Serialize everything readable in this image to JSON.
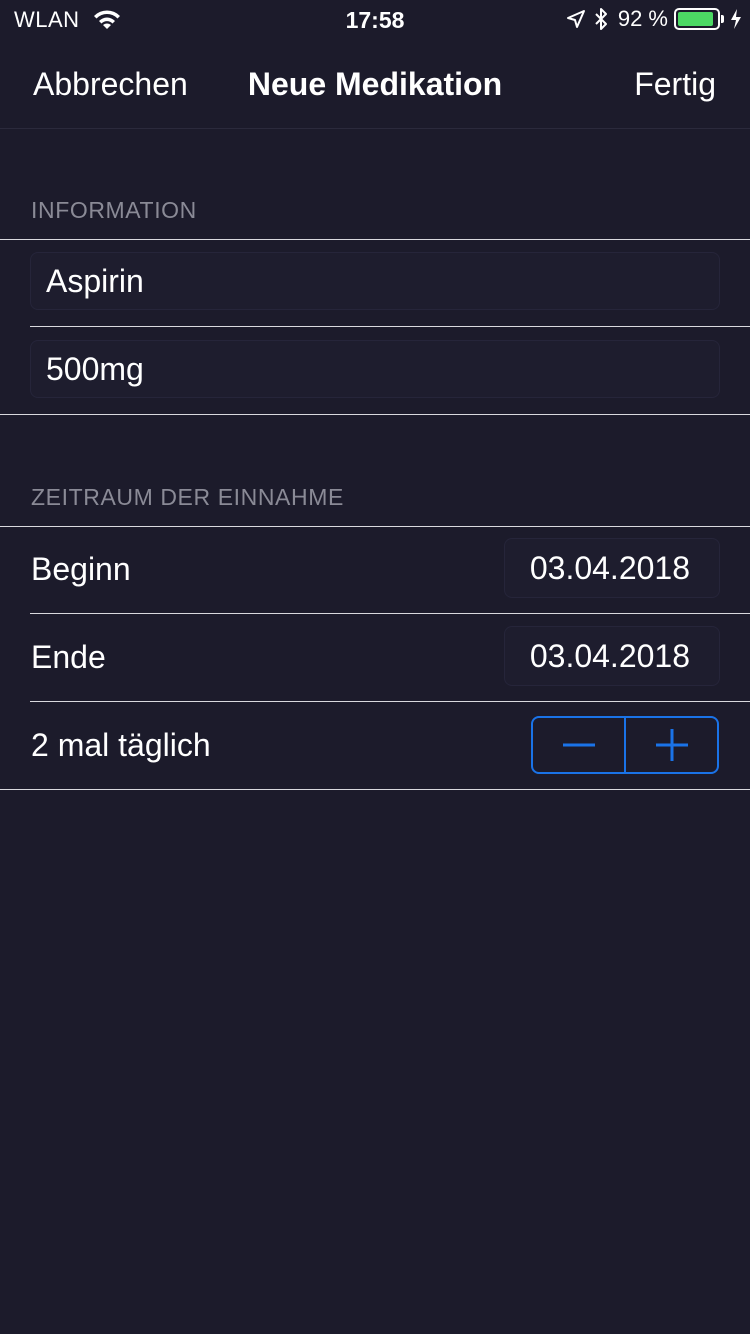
{
  "status_bar": {
    "carrier": "WLAN",
    "time": "17:58",
    "battery_percent_label": "92 %",
    "battery_level": 0.92,
    "battery_color": "#4cd964"
  },
  "navbar": {
    "cancel_label": "Abbrechen",
    "title": "Neue Medikation",
    "done_label": "Fertig"
  },
  "information": {
    "header": "INFORMATION",
    "name_value": "Aspirin",
    "dosage_value": "500mg"
  },
  "period": {
    "header": "ZEITRAUM DER EINNAHME",
    "begin_label": "Beginn",
    "begin_value": "03.04.2018",
    "end_label": "Ende",
    "end_value": "03.04.2018",
    "frequency_label": "2 mal täglich",
    "stepper_color": "#1a73e8"
  },
  "icons": [
    "wifi-icon",
    "location-arrow-icon",
    "bluetooth-icon",
    "battery-icon",
    "charging-bolt-icon",
    "minus-icon",
    "plus-icon"
  ]
}
